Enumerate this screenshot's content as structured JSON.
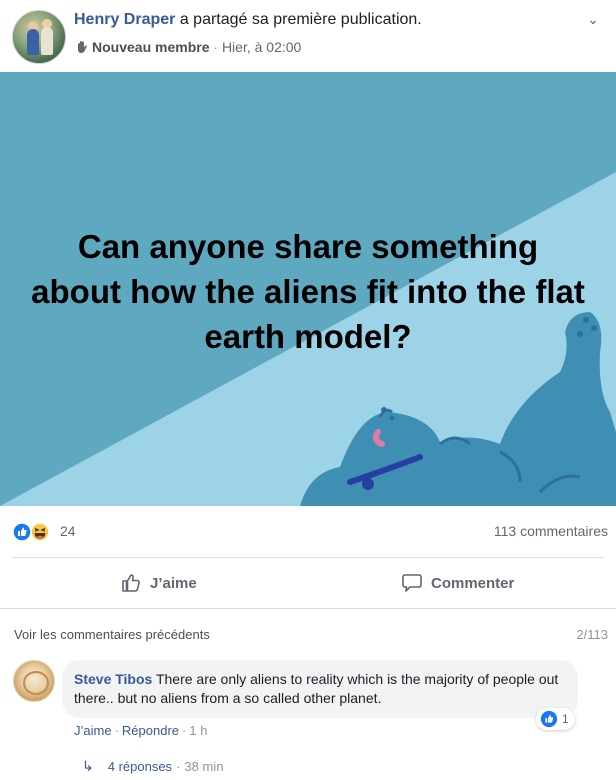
{
  "post": {
    "author": "Henry Draper",
    "action": " a partagé sa première publication.",
    "badge": "Nouveau membre",
    "separator": "·",
    "timestamp": "Hier, à 02:00",
    "image_text": "Can anyone share something about how the aliens fit into the flat earth model?"
  },
  "reactions": {
    "count": "24",
    "comments_count": "113 commentaires",
    "types": [
      "like-icon",
      "haha-icon"
    ]
  },
  "actions": {
    "like_label": "J’aime",
    "comment_label": "Commenter"
  },
  "comments": {
    "view_previous": "Voir les commentaires précédents",
    "page_count": "2/113",
    "items": [
      {
        "author": "Steve Tibos",
        "text": " There are only aliens to reality which is the majority of people out there.. but no aliens from a so called other planet.",
        "like_count": "1",
        "like": "J’aime",
        "reply": "Répondre",
        "time": "1 h",
        "replies_label": "4 réponses",
        "replies_time": "38 min"
      }
    ]
  },
  "colors": {
    "link": "#385898",
    "image_bg_dark": "#5ea8c0",
    "image_bg_light": "#9dd3e6",
    "creature": "#3f8fb5",
    "like_blue": "#1877f2",
    "haha_yellow": "#f7c64a"
  }
}
